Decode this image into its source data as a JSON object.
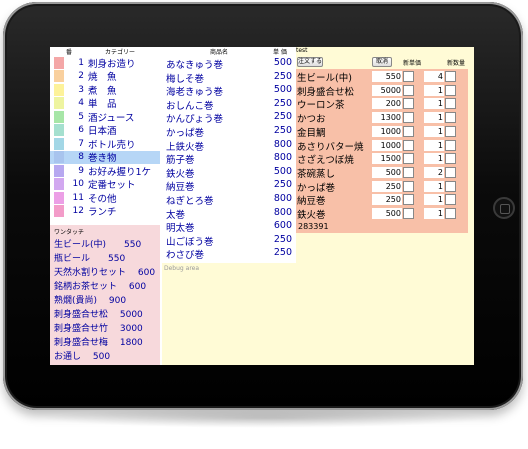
{
  "categories_header": {
    "num": "番",
    "name": "カテゴリー"
  },
  "categories": [
    {
      "num": "1",
      "name": "刺身お造り",
      "color": "#f4a7a7"
    },
    {
      "num": "2",
      "name": "焼　魚",
      "color": "#f9d09e"
    },
    {
      "num": "3",
      "name": "煮　魚",
      "color": "#fdf29a"
    },
    {
      "num": "4",
      "name": "単　品",
      "color": "#eef4a0"
    },
    {
      "num": "5",
      "name": "酒ジュース",
      "color": "#a7e6a7"
    },
    {
      "num": "6",
      "name": "日本酒",
      "color": "#a5e0cf"
    },
    {
      "num": "7",
      "name": "ボトル売り",
      "color": "#a3d7e6"
    },
    {
      "num": "8",
      "name": "巻き物",
      "color": "#a8c4ee",
      "selected": true
    },
    {
      "num": "9",
      "name": "お好み握り1ケ",
      "color": "#b7a8f0"
    },
    {
      "num": "10",
      "name": "定番セット",
      "color": "#d2a8f0"
    },
    {
      "num": "11",
      "name": "その他",
      "color": "#ec9fe6"
    },
    {
      "num": "12",
      "name": "ランチ",
      "color": "#f39cc9"
    }
  ],
  "onetouch_header": "ワンタッチ",
  "onetouch": [
    "生ビール(中)　　550",
    "瓶ビール　　550",
    "天然水割りセット　 600",
    "銘柄お茶セット　 600",
    "熟燗(貴尚)　 900",
    "刺身盛合せ松　 5000",
    "刺身盛合せ竹　 3000",
    "刺身盛合せ梅　 1800",
    "お通し　 500"
  ],
  "items_header": {
    "name": "商品名",
    "price": "単 価"
  },
  "items": [
    {
      "name": "あなきゅう巻",
      "price": "500"
    },
    {
      "name": "梅しそ巻",
      "price": "250"
    },
    {
      "name": "海老きゅう巻",
      "price": "500"
    },
    {
      "name": "おしんこ巻",
      "price": "250"
    },
    {
      "name": "かんぴょう巻",
      "price": "250"
    },
    {
      "name": "かっぱ巻",
      "price": "250"
    },
    {
      "name": "上鉄火巻",
      "price": "800"
    },
    {
      "name": "筋子巻",
      "price": "800"
    },
    {
      "name": "鉄火巻",
      "price": "500"
    },
    {
      "name": "納豆巻",
      "price": "250"
    },
    {
      "name": "ねぎとろ巻",
      "price": "800"
    },
    {
      "name": "太巻",
      "price": "800"
    },
    {
      "name": "明太巻",
      "price": "600"
    },
    {
      "name": "山ごぼう巻",
      "price": "250"
    },
    {
      "name": "わさび巻",
      "price": "250"
    }
  ],
  "debug_text": "Debug area",
  "order": {
    "test_label": "test",
    "order_button": "注文する",
    "cancel_button": "取消",
    "new_price_header": "新単価",
    "new_qty_header": "新数量",
    "rows": [
      {
        "name": "生ビール(中)",
        "price": "550",
        "qty": "4"
      },
      {
        "name": "刺身盛合せ松",
        "price": "5000",
        "qty": "1"
      },
      {
        "name": "ウーロン茶",
        "price": "200",
        "qty": "1"
      },
      {
        "name": "かつお",
        "price": "1300",
        "qty": "1"
      },
      {
        "name": "金目鯛",
        "price": "1000",
        "qty": "1"
      },
      {
        "name": "あさりバター焼",
        "price": "1000",
        "qty": "1"
      },
      {
        "name": "さざえつぼ焼",
        "price": "1500",
        "qty": "1"
      },
      {
        "name": "茶碗蒸し",
        "price": "500",
        "qty": "2"
      },
      {
        "name": "かっぱ巻",
        "price": "250",
        "qty": "1"
      },
      {
        "name": "納豆巻",
        "price": "250",
        "qty": "1"
      },
      {
        "name": "鉄火巻",
        "price": "500",
        "qty": "1"
      }
    ],
    "total": "283391"
  }
}
